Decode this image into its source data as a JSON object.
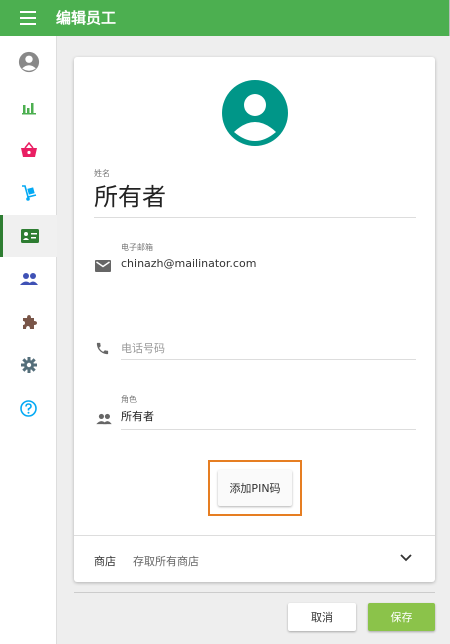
{
  "header": {
    "title": "编辑员工",
    "menu_icon": "hamburger-menu-icon"
  },
  "sidebar": {
    "items": [
      {
        "icon": "account-circle-icon",
        "color": "#888888"
      },
      {
        "icon": "bar-chart-icon",
        "color": "#4caf50"
      },
      {
        "icon": "shopping-basket-icon",
        "color": "#e91e63"
      },
      {
        "icon": "dolly-icon",
        "color": "#03a9f4"
      },
      {
        "icon": "employee-card-icon",
        "color": "#2e7d32",
        "active": true
      },
      {
        "icon": "people-icon",
        "color": "#3f51b5"
      },
      {
        "icon": "puzzle-icon",
        "color": "#795548"
      },
      {
        "icon": "settings-icon",
        "color": "#546e7a"
      },
      {
        "icon": "help-icon",
        "color": "#03a9f4"
      }
    ]
  },
  "form": {
    "avatar_color": "#009688",
    "name_label": "姓名",
    "name_value": "所有者",
    "email_label": "电子邮箱",
    "email_value": "chinazh@mailinator.com",
    "phone_placeholder": "电话号码",
    "role_label": "角色",
    "role_value": "所有者",
    "pin_button": "添加PIN码",
    "highlight_color": "#e67e22"
  },
  "store": {
    "label": "商店",
    "value": "存取所有商店"
  },
  "footer": {
    "cancel_label": "取消",
    "save_label": "保存",
    "save_color": "#8bc34a"
  }
}
